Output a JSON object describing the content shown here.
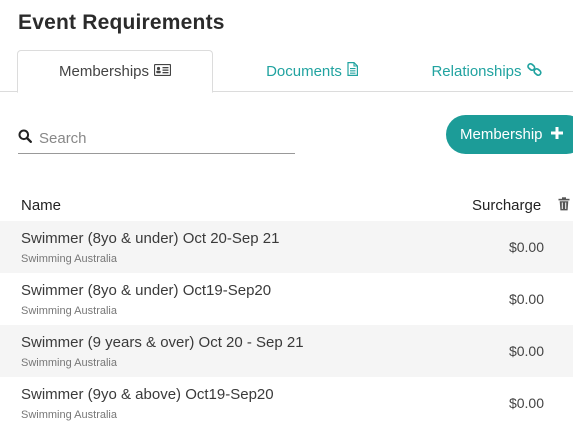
{
  "page": {
    "title": "Event Requirements"
  },
  "tabs": [
    {
      "label": "Memberships",
      "icon": "id-card-icon",
      "active": true
    },
    {
      "label": "Documents",
      "icon": "document-icon",
      "active": false
    },
    {
      "label": "Relationships",
      "icon": "link-icon",
      "active": false
    }
  ],
  "search": {
    "placeholder": "Search",
    "value": "",
    "icon": "search-icon"
  },
  "add_button": {
    "label": "Membership",
    "icon": "plus-icon"
  },
  "table": {
    "columns": {
      "name": "Name",
      "surcharge": "Surcharge"
    },
    "rows": [
      {
        "name": "Swimmer (8yo & under) Oct 20-Sep 21",
        "org": "Swimming Australia",
        "surcharge": "$0.00"
      },
      {
        "name": "Swimmer (8yo & under) Oct19-Sep20",
        "org": "Swimming Australia",
        "surcharge": "$0.00"
      },
      {
        "name": "Swimmer (9 years & over) Oct 20 - Sep 21",
        "org": "Swimming Australia",
        "surcharge": "$0.00"
      },
      {
        "name": "Swimmer (9yo & above) Oct19-Sep20",
        "org": "Swimming Australia",
        "surcharge": "$0.00"
      }
    ]
  },
  "colors": {
    "accent": "#1c9c98",
    "tab_link": "#21a3a0"
  }
}
